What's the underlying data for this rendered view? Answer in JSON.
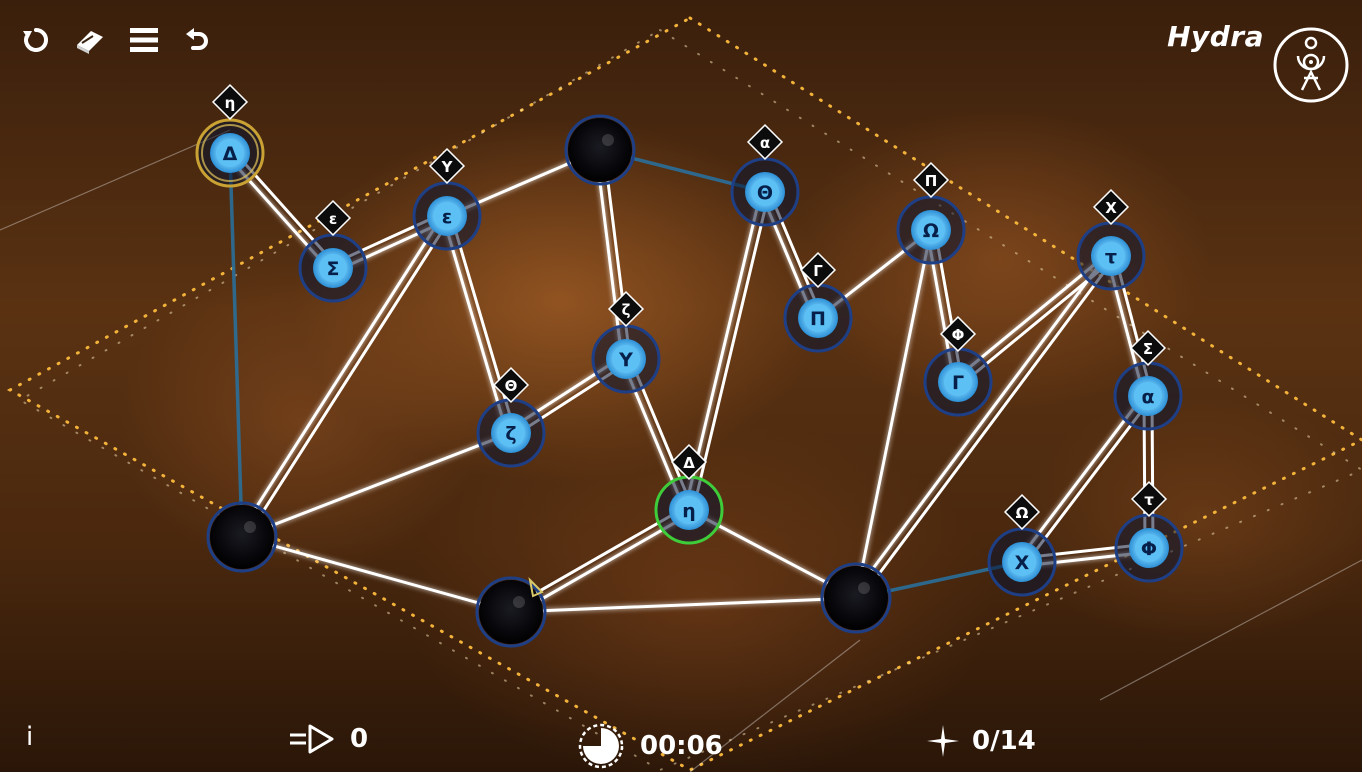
{
  "level": {
    "title": "Hydra",
    "emblem_icon": "hydra-constellation-emblem"
  },
  "toolbar": [
    {
      "name": "restart-icon",
      "icon": "circular-arrow"
    },
    {
      "name": "eraser-icon",
      "icon": "eraser"
    },
    {
      "name": "menu-icon",
      "icon": "hamburger"
    },
    {
      "name": "undo-icon",
      "icon": "curved-back-arrow"
    }
  ],
  "stats": {
    "info_label": "i",
    "moves": "0",
    "timer": "00:06",
    "stars": "0/14"
  },
  "colors": {
    "node_fill": "#5cc0f5",
    "node_ring": "#1e3f86",
    "selected_ring": "#3fcc3a",
    "gold_ring": "#c9a233",
    "edge": "#ffffff",
    "blue_edge": "#2a6f9a",
    "boundary_dots": "#f3b33a"
  },
  "nodes": [
    {
      "id": "n1",
      "label": "Δ",
      "tag": "η",
      "state": "gold"
    },
    {
      "id": "n2",
      "label": "Σ",
      "tag": "ε",
      "state": "normal"
    },
    {
      "id": "n3",
      "label": "ε",
      "tag": "Υ",
      "state": "normal"
    },
    {
      "id": "n4",
      "label": "",
      "tag": "",
      "state": "dark"
    },
    {
      "id": "n5",
      "label": "Θ",
      "tag": "α",
      "state": "normal"
    },
    {
      "id": "n6",
      "label": "Π",
      "tag": "Γ",
      "state": "normal"
    },
    {
      "id": "n7",
      "label": "Ω",
      "tag": "Π",
      "state": "normal"
    },
    {
      "id": "n8",
      "label": "Γ",
      "tag": "Φ",
      "state": "normal"
    },
    {
      "id": "n9",
      "label": "τ",
      "tag": "Χ",
      "state": "normal"
    },
    {
      "id": "n10",
      "label": "α",
      "tag": "Σ",
      "state": "normal"
    },
    {
      "id": "n11",
      "label": "Υ",
      "tag": "ζ",
      "state": "normal"
    },
    {
      "id": "n12",
      "label": "ζ",
      "tag": "Θ",
      "state": "normal"
    },
    {
      "id": "n13",
      "label": "η",
      "tag": "Δ",
      "state": "selected"
    },
    {
      "id": "n14",
      "label": "",
      "tag": "",
      "state": "dark"
    },
    {
      "id": "n15",
      "label": "",
      "tag": "",
      "state": "dark"
    },
    {
      "id": "n16",
      "label": "",
      "tag": "",
      "state": "dark"
    },
    {
      "id": "n17",
      "label": "Χ",
      "tag": "Ω",
      "state": "normal"
    },
    {
      "id": "n18",
      "label": "Φ",
      "tag": "τ",
      "state": "normal"
    }
  ],
  "edges": [
    {
      "a": "n1",
      "b": "n2",
      "type": "double"
    },
    {
      "a": "n1",
      "b": "n14",
      "type": "blue"
    },
    {
      "a": "n2",
      "b": "n3",
      "type": "double"
    },
    {
      "a": "n3",
      "b": "n4",
      "type": "single"
    },
    {
      "a": "n3",
      "b": "n12",
      "type": "double"
    },
    {
      "a": "n3",
      "b": "n14",
      "type": "double"
    },
    {
      "a": "n4",
      "b": "n5",
      "type": "blue"
    },
    {
      "a": "n4",
      "b": "n11",
      "type": "double"
    },
    {
      "a": "n5",
      "b": "n6",
      "type": "double"
    },
    {
      "a": "n5",
      "b": "n13",
      "type": "double"
    },
    {
      "a": "n6",
      "b": "n7",
      "type": "single"
    },
    {
      "a": "n7",
      "b": "n8",
      "type": "double"
    },
    {
      "a": "n7",
      "b": "n16",
      "type": "single"
    },
    {
      "a": "n9",
      "b": "n8",
      "type": "double"
    },
    {
      "a": "n9",
      "b": "n10",
      "type": "double"
    },
    {
      "a": "n9",
      "b": "n16",
      "type": "double"
    },
    {
      "a": "n10",
      "b": "n17",
      "type": "double"
    },
    {
      "a": "n10",
      "b": "n18",
      "type": "double"
    },
    {
      "a": "n11",
      "b": "n12",
      "type": "double"
    },
    {
      "a": "n11",
      "b": "n13",
      "type": "double"
    },
    {
      "a": "n12",
      "b": "n14",
      "type": "single"
    },
    {
      "a": "n14",
      "b": "n15",
      "type": "single"
    },
    {
      "a": "n15",
      "b": "n13",
      "type": "double"
    },
    {
      "a": "n15",
      "b": "n16",
      "type": "single"
    },
    {
      "a": "n13",
      "b": "n16",
      "type": "single"
    },
    {
      "a": "n16",
      "b": "n17",
      "type": "blue"
    },
    {
      "a": "n17",
      "b": "n18",
      "type": "double"
    }
  ]
}
